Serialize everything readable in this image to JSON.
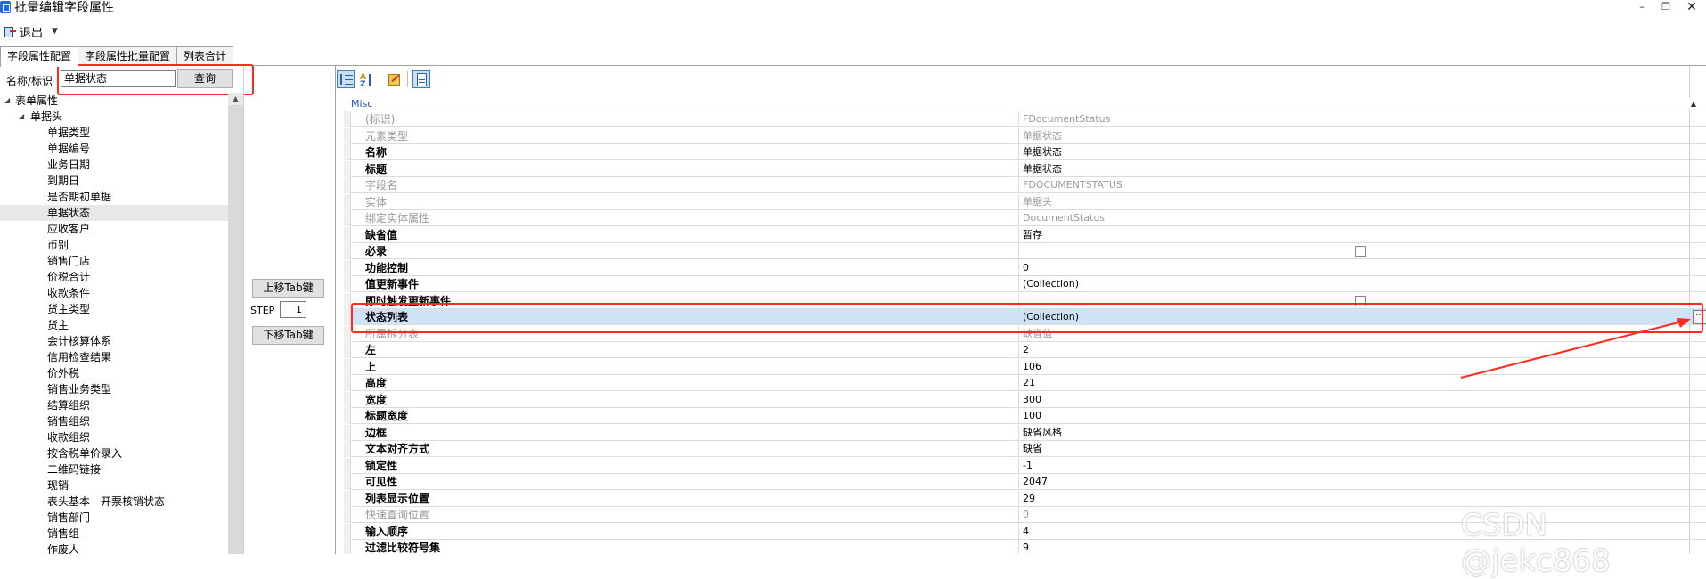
{
  "window": {
    "title": "批量编辑字段属性"
  },
  "toolbar": {
    "exit_label": "退出"
  },
  "tabs": [
    {
      "label": "字段属性配置"
    },
    {
      "label": "字段属性批量配置"
    },
    {
      "label": "列表合计"
    }
  ],
  "search": {
    "label": "名称/标识",
    "value": "单据状态",
    "button": "查询"
  },
  "tree": {
    "root": "表单属性",
    "group": "单据头",
    "selected": "单据状态",
    "items": [
      "单据类型",
      "单据编号",
      "业务日期",
      "到期日",
      "是否期初单据",
      "单据状态",
      "应收客户",
      "币别",
      "销售门店",
      "价税合计",
      "收款条件",
      "货主类型",
      "货主",
      "会计核算体系",
      "信用检查结果",
      "价外税",
      "销售业务类型",
      "结算组织",
      "销售组织",
      "收款组织",
      "按含税单价录入",
      "二维码链接",
      "现销",
      "表头基本 - 开票核销状态",
      "销售部门",
      "销售组",
      "作废人"
    ]
  },
  "middle": {
    "move_up": "上移Tab键",
    "step_label": "STEP",
    "step_value": "1",
    "move_down": "下移Tab键"
  },
  "grid": {
    "category": "Misc",
    "rows": [
      {
        "name": "(标识)",
        "value": "FDocumentStatus",
        "bold": false,
        "gray": true
      },
      {
        "name": "元素类型",
        "value": "单据状态",
        "bold": false,
        "gray": true
      },
      {
        "name": "名称",
        "value": "单据状态",
        "bold": true,
        "gray": false
      },
      {
        "name": "标题",
        "value": "单据状态",
        "bold": true,
        "gray": false
      },
      {
        "name": "字段名",
        "value": "FDOCUMENTSTATUS",
        "bold": false,
        "gray": true
      },
      {
        "name": "实体",
        "value": "单据头",
        "bold": false,
        "gray": true
      },
      {
        "name": "绑定实体属性",
        "value": "DocumentStatus",
        "bold": false,
        "gray": true
      },
      {
        "name": "缺省值",
        "value": "暂存",
        "bold": true,
        "gray": false
      },
      {
        "name": "必录",
        "value": "",
        "bold": true,
        "gray": false,
        "checkbox": true
      },
      {
        "name": "功能控制",
        "value": "0",
        "bold": true,
        "gray": false
      },
      {
        "name": "值更新事件",
        "value": "(Collection)",
        "bold": true,
        "gray": false
      },
      {
        "name": "即时触发更新事件",
        "value": "",
        "bold": true,
        "gray": false,
        "checkbox": true
      },
      {
        "name": "状态列表",
        "value": "(Collection)",
        "bold": true,
        "gray": false,
        "selected": true,
        "ellipsis": true
      },
      {
        "name": "所属拆分表",
        "value": "缺省值",
        "bold": false,
        "gray": true
      },
      {
        "name": "左",
        "value": "2",
        "bold": true,
        "gray": false
      },
      {
        "name": "上",
        "value": "106",
        "bold": true,
        "gray": false
      },
      {
        "name": "高度",
        "value": "21",
        "bold": true,
        "gray": false
      },
      {
        "name": "宽度",
        "value": "300",
        "bold": true,
        "gray": false
      },
      {
        "name": "标题宽度",
        "value": "100",
        "bold": true,
        "gray": false
      },
      {
        "name": "边框",
        "value": "缺省风格",
        "bold": true,
        "gray": false
      },
      {
        "name": "文本对齐方式",
        "value": "缺省",
        "bold": true,
        "gray": false
      },
      {
        "name": "锁定性",
        "value": "-1",
        "bold": true,
        "gray": false
      },
      {
        "name": "可见性",
        "value": "2047",
        "bold": true,
        "gray": false
      },
      {
        "name": "列表显示位置",
        "value": "29",
        "bold": true,
        "gray": false
      },
      {
        "name": "快速查询位置",
        "value": "0",
        "bold": false,
        "gray": true
      },
      {
        "name": "输入顺序",
        "value": "4",
        "bold": true,
        "gray": false
      },
      {
        "name": "过滤比较符号集",
        "value": "9",
        "bold": true,
        "gray": false
      }
    ]
  },
  "watermark": "CSDN @jekc868",
  "colors": {
    "highlight_red": "#ff2b1f",
    "selected_row": "#cfe3f7",
    "category_blue": "#1f4fbf"
  }
}
